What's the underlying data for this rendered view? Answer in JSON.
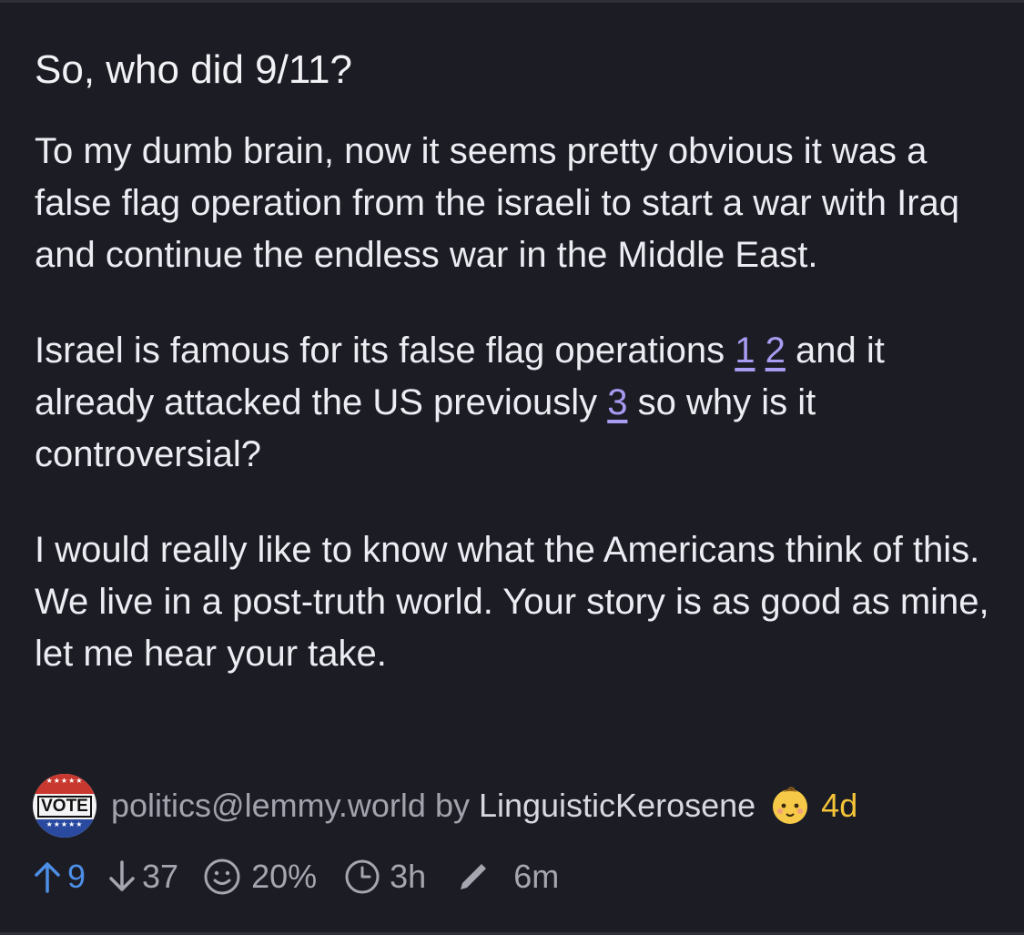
{
  "post": {
    "title": "So, who did 9/11?",
    "body": {
      "p1": "To my dumb brain, now it seems pretty obvious it was a false flag operation from the israeli to start a war with Iraq and continue the endless war in the Middle East.",
      "p2_before_links": "Israel is famous for its false flag operations ",
      "link1": "1",
      "link2": "2",
      "p2_mid": " and it already attacked the US previously ",
      "link3": "3",
      "p2_after": " so why is it controversial?",
      "p3": "I would really like to know what the Americans think of this. We live in a post-truth world. Your story is as good as mine, let me hear your take."
    }
  },
  "meta": {
    "avatar_text": "VOTE",
    "community": "politics@lemmy.world",
    "by": "by",
    "author": "LinguisticKerosene",
    "author_badge_icon": "baby-face-icon",
    "age": "4d",
    "age_color": "#f3c338"
  },
  "stats": {
    "upvotes": "9",
    "downvotes": "37",
    "ratio": "20%",
    "time": "3h",
    "edited": "6m",
    "upvote_color": "#4d8fe6"
  }
}
